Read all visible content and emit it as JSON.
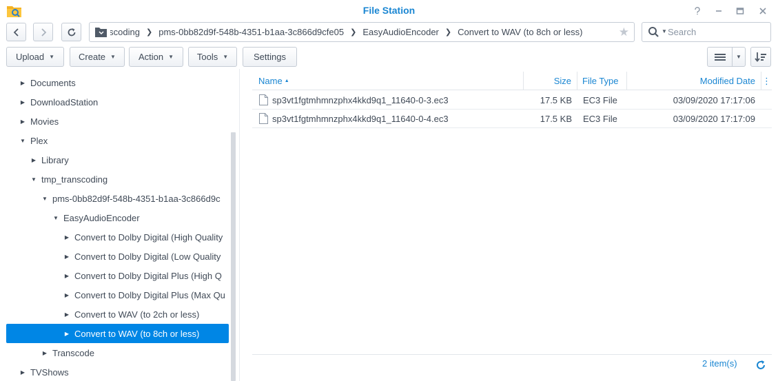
{
  "window": {
    "title": "File Station",
    "app_icon": "file-station-icon",
    "controls": [
      "help-icon",
      "minimize-icon",
      "maximize-icon",
      "close-icon"
    ]
  },
  "navigation": {
    "back": "chevron-left-icon",
    "forward": "chevron-right-icon",
    "refresh": "refresh-icon"
  },
  "path": {
    "crumbs": [
      "tmp_transcoding",
      "pms-0bb82d9f-548b-4351-b1aa-3c866d9cfe05",
      "EasyAudioEncoder",
      "Convert to WAV (to 8ch or less)"
    ]
  },
  "search": {
    "placeholder": "Search"
  },
  "toolbar": {
    "upload": "Upload",
    "create": "Create",
    "action": "Action",
    "tools": "Tools",
    "settings": "Settings"
  },
  "tree": {
    "items": [
      {
        "label": "Documents",
        "state": "collapsed"
      },
      {
        "label": "DownloadStation",
        "state": "collapsed"
      },
      {
        "label": "Movies",
        "state": "collapsed"
      },
      {
        "label": "Plex",
        "state": "expanded"
      },
      {
        "label": "Library",
        "state": "collapsed"
      },
      {
        "label": "tmp_transcoding",
        "state": "expanded"
      },
      {
        "label": "pms-0bb82d9f-548b-4351-b1aa-3c866d9c",
        "state": "expanded"
      },
      {
        "label": "EasyAudioEncoder",
        "state": "expanded"
      },
      {
        "label": "Convert to Dolby Digital (High Quality",
        "state": "collapsed"
      },
      {
        "label": "Convert to Dolby Digital (Low Quality",
        "state": "collapsed"
      },
      {
        "label": "Convert to Dolby Digital Plus (High Q",
        "state": "collapsed"
      },
      {
        "label": "Convert to Dolby Digital Plus (Max Qu",
        "state": "collapsed"
      },
      {
        "label": "Convert to WAV (to 2ch or less)",
        "state": "collapsed"
      },
      {
        "label": "Convert to WAV (to 8ch or less)",
        "state": "collapsed",
        "selected": true
      },
      {
        "label": "Transcode",
        "state": "collapsed"
      },
      {
        "label": "TVShows",
        "state": "collapsed"
      }
    ]
  },
  "grid": {
    "columns": {
      "name": "Name",
      "size": "Size",
      "type": "File Type",
      "modified": "Modified Date"
    },
    "sort": {
      "column": "Name",
      "direction": "ascending"
    },
    "rows": [
      {
        "name": "sp3vt1fgtmhmnzphx4kkd9q1_11640-0-3.ec3",
        "size": "17.5 KB",
        "type": "EC3 File",
        "modified": "03/09/2020 17:17:06"
      },
      {
        "name": "sp3vt1fgtmhmnzphx4kkd9q1_11640-0-4.ec3",
        "size": "17.5 KB",
        "type": "EC3 File",
        "modified": "03/09/2020 17:17:09"
      }
    ]
  },
  "status": {
    "count": "2 item(s)"
  },
  "colors": {
    "accent": "#1a86d2",
    "selection": "#0086e5",
    "text": "#404a57",
    "border": "#c5ccd5"
  }
}
